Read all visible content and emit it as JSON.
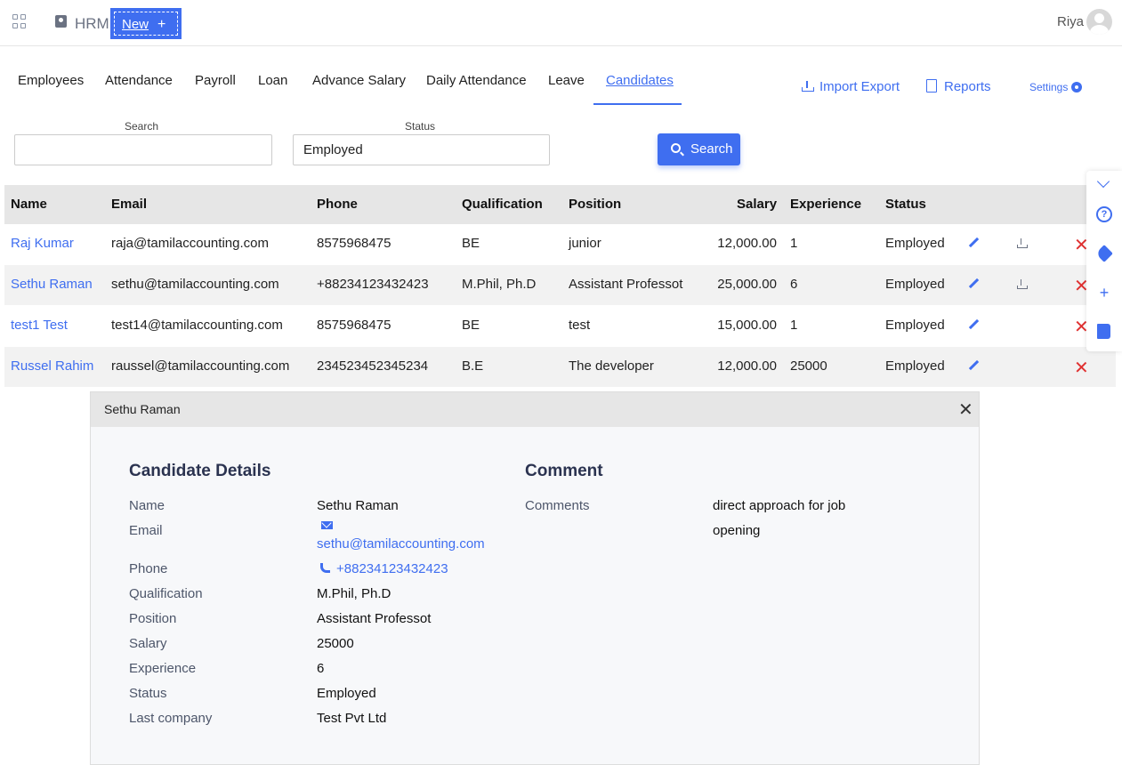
{
  "header": {
    "app_name": "HRM",
    "new_button": "New",
    "new_plus": "+",
    "user_name": "Riya"
  },
  "tabs": [
    {
      "label": "Employees"
    },
    {
      "label": "Attendance"
    },
    {
      "label": "Payroll"
    },
    {
      "label": "Loan"
    },
    {
      "label": "Advance Salary"
    },
    {
      "label": "Daily Attendance"
    },
    {
      "label": "Leave"
    },
    {
      "label": "Candidates",
      "active": true
    }
  ],
  "actions": {
    "import_export": "Import Export",
    "reports": "Reports",
    "settings": "Settings"
  },
  "filters": {
    "search_label": "Search",
    "search_value": "",
    "status_label": "Status",
    "status_value": "Employed",
    "search_button": "Search"
  },
  "table": {
    "columns": [
      "Name",
      "Email",
      "Phone",
      "Qualification",
      "Position",
      "Salary",
      "Experience",
      "Status"
    ],
    "rows": [
      {
        "name": "Raj Kumar",
        "email": "raja@tamilaccounting.com",
        "phone": "8575968475",
        "qualification": "BE",
        "position": "junior",
        "salary": "12,000.00",
        "experience": "1",
        "status": "Employed",
        "has_download": true
      },
      {
        "name": "Sethu Raman",
        "email": "sethu@tamilaccounting.com",
        "phone": "+88234123432423",
        "qualification": "M.Phil, Ph.D",
        "position": "Assistant Professot",
        "salary": "25,000.00",
        "experience": "6",
        "status": "Employed",
        "has_download": true
      },
      {
        "name": "test1 Test",
        "email": "test14@tamilaccounting.com",
        "phone": "8575968475",
        "qualification": "BE",
        "position": "test",
        "salary": "15,000.00",
        "experience": "1",
        "status": "Employed",
        "has_download": false
      },
      {
        "name": "Russel Rahim",
        "email": "raussel@tamilaccounting.com",
        "phone": "234523452345234",
        "qualification": "B.E",
        "position": "The developer",
        "salary": "12,000.00",
        "experience": "25000",
        "status": "Employed",
        "has_download": false
      }
    ]
  },
  "modal": {
    "title": "Sethu Raman",
    "details_heading": "Candidate Details",
    "comment_heading": "Comment",
    "details": [
      {
        "label": "Name",
        "value": "Sethu Raman"
      },
      {
        "label": "Email",
        "value": "sethu@tamilaccounting.com"
      },
      {
        "label": "Phone",
        "value": "+88234123432423"
      },
      {
        "label": "Qualification",
        "value": "M.Phil, Ph.D"
      },
      {
        "label": "Position",
        "value": "Assistant Professot"
      },
      {
        "label": "Salary",
        "value": "25000"
      },
      {
        "label": "Experience",
        "value": "6"
      },
      {
        "label": "Status",
        "value": "Employed"
      },
      {
        "label": "Last company",
        "value": "Test Pvt Ltd"
      }
    ],
    "comments_label": "Comments",
    "comments_line1": "direct approach for job",
    "comments_line2": "opening"
  },
  "colors": {
    "accent": "#3f6ef0",
    "delete": "#e03131",
    "header_bg": "#e6e6e6"
  },
  "icons": [
    "apps-grid-icon",
    "hrm-icon",
    "avatar",
    "download-icon",
    "pdf-icon",
    "gear-icon",
    "search-icon",
    "edit-icon",
    "delete-icon",
    "chevron-down-icon",
    "help-icon",
    "pin-icon",
    "plus-icon",
    "book-icon",
    "close-icon",
    "mail-icon",
    "phone-icon"
  ]
}
